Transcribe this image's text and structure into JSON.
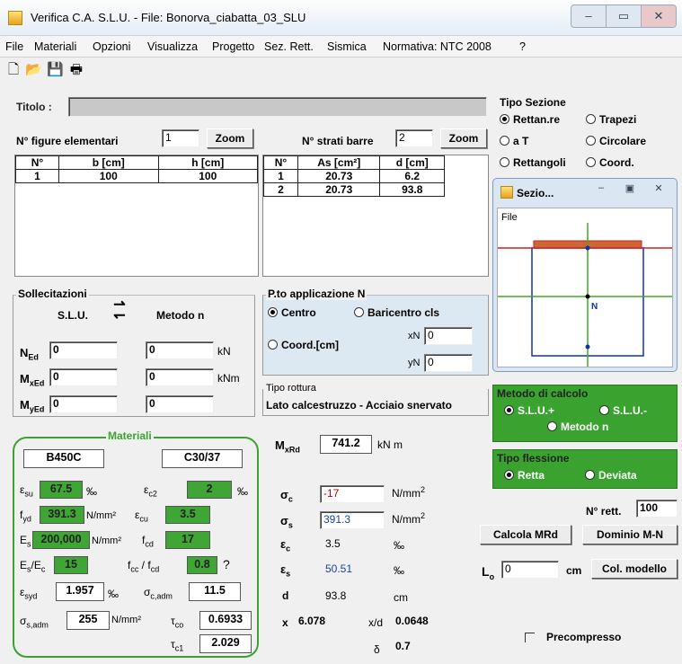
{
  "window": {
    "title": "Verifica C.A. S.L.U. - File: Bonorva_ciabatta_03_SLU",
    "buttons": [
      "–",
      "▭",
      "✕"
    ]
  },
  "menu": [
    "File",
    "Materiali",
    "Opzioni",
    "Visualizza",
    "Progetto",
    "Sez. Rett.",
    "Sismica",
    "Normativa: NTC 2008",
    "?"
  ],
  "titolo": {
    "label": "Titolo :",
    "value": ""
  },
  "tipo_sezione": {
    "label": "Tipo Sezione",
    "options": [
      "Rettan.re",
      "Trapezi",
      "a T",
      "Circolare",
      "Rettangoli",
      "Coord."
    ],
    "selected": "Rettan.re"
  },
  "figure": {
    "label": "N° figure elementari",
    "count": "1",
    "zoom": "Zoom",
    "headers": [
      "N°",
      "b [cm]",
      "h [cm]"
    ],
    "rows": [
      [
        "1",
        "100",
        "100"
      ]
    ]
  },
  "strati": {
    "label": "N° strati barre",
    "count": "2",
    "zoom": "Zoom",
    "headers": [
      "N°",
      "As [cm²]",
      "d [cm]"
    ],
    "rows": [
      [
        "1",
        "20.73",
        "6.2"
      ],
      [
        "2",
        "20.73",
        "93.8"
      ]
    ]
  },
  "sezione_win": {
    "title": "Sezio...",
    "menu": "File",
    "marker": "N"
  },
  "sollecitazioni": {
    "label": "Sollecitazioni",
    "slu": "S.L.U.",
    "metodo": "Metodo n",
    "rows": [
      {
        "name": "N",
        "sub": "Ed",
        "v1": "0",
        "v2": "0",
        "unit": "kN"
      },
      {
        "name": "M",
        "sub": "xEd",
        "v1": "0",
        "v2": "0",
        "unit": "kNm"
      },
      {
        "name": "M",
        "sub": "yEd",
        "v1": "0",
        "v2": "0",
        "unit": ""
      }
    ]
  },
  "applicazione": {
    "label": "P.to applicazione N",
    "options": [
      "Centro",
      "Baricentro cls",
      "Coord.[cm]"
    ],
    "selected": "Centro",
    "xN": "0",
    "yN": "0"
  },
  "rottura": {
    "label": "Tipo rottura",
    "value": "Lato calcestruzzo - Acciaio snervato"
  },
  "metodo_calcolo": {
    "label": "Metodo di calcolo",
    "options": [
      "S.L.U.+",
      "S.L.U.-",
      "Metodo n"
    ],
    "selected": "S.L.U.+"
  },
  "tipo_flessione": {
    "label": "Tipo flessione",
    "options": [
      "Retta",
      "Deviata"
    ],
    "selected": "Retta"
  },
  "materiali": {
    "label": "Materiali",
    "acciaio": "B450C",
    "cls": "C30/37",
    "esu": "67.5",
    "ec2": "2",
    "fyd": "391.3",
    "ecu": "3.5",
    "Es": "200,000",
    "fcd": "17",
    "EsEc": "15",
    "fccfcd": "0.8",
    "esyd": "1.957",
    "sigc_adm": "11.5",
    "sigs_adm": "255",
    "tau_co": "0.6933",
    "tau_c1": "2.029",
    "u_permille": "‰",
    "u_nmm2": "N/mm²",
    "fcc_q": "?"
  },
  "risultati": {
    "MxRd": "741.2",
    "MxRd_unit": "kN m",
    "sigc": "-17",
    "sigs": "391.3",
    "ec": "3.5",
    "es": "50.51",
    "d": "93.8",
    "x": "6.078",
    "xd": "0.0648",
    "delta": "0.7",
    "u_nmm2": "N/mm",
    "u_permille": "‰",
    "u_cm": "cm"
  },
  "n_rett": {
    "label": "N° rett.",
    "value": "100"
  },
  "buttons": {
    "calcola": "Calcola MRd",
    "dominio": "Dominio M-N",
    "col_modello": "Col. modello"
  },
  "L0": {
    "label": "L",
    "value": "0",
    "unit": "cm"
  },
  "precompresso": {
    "label": "Precompresso"
  },
  "colors": {
    "green": "#3aa32f",
    "sigma_c_red": "#c00000",
    "sigma_s_blue": "#1a3fa0",
    "section_red": "#d02020",
    "section_green": "#44aa22",
    "section_blue": "#1030b0"
  }
}
